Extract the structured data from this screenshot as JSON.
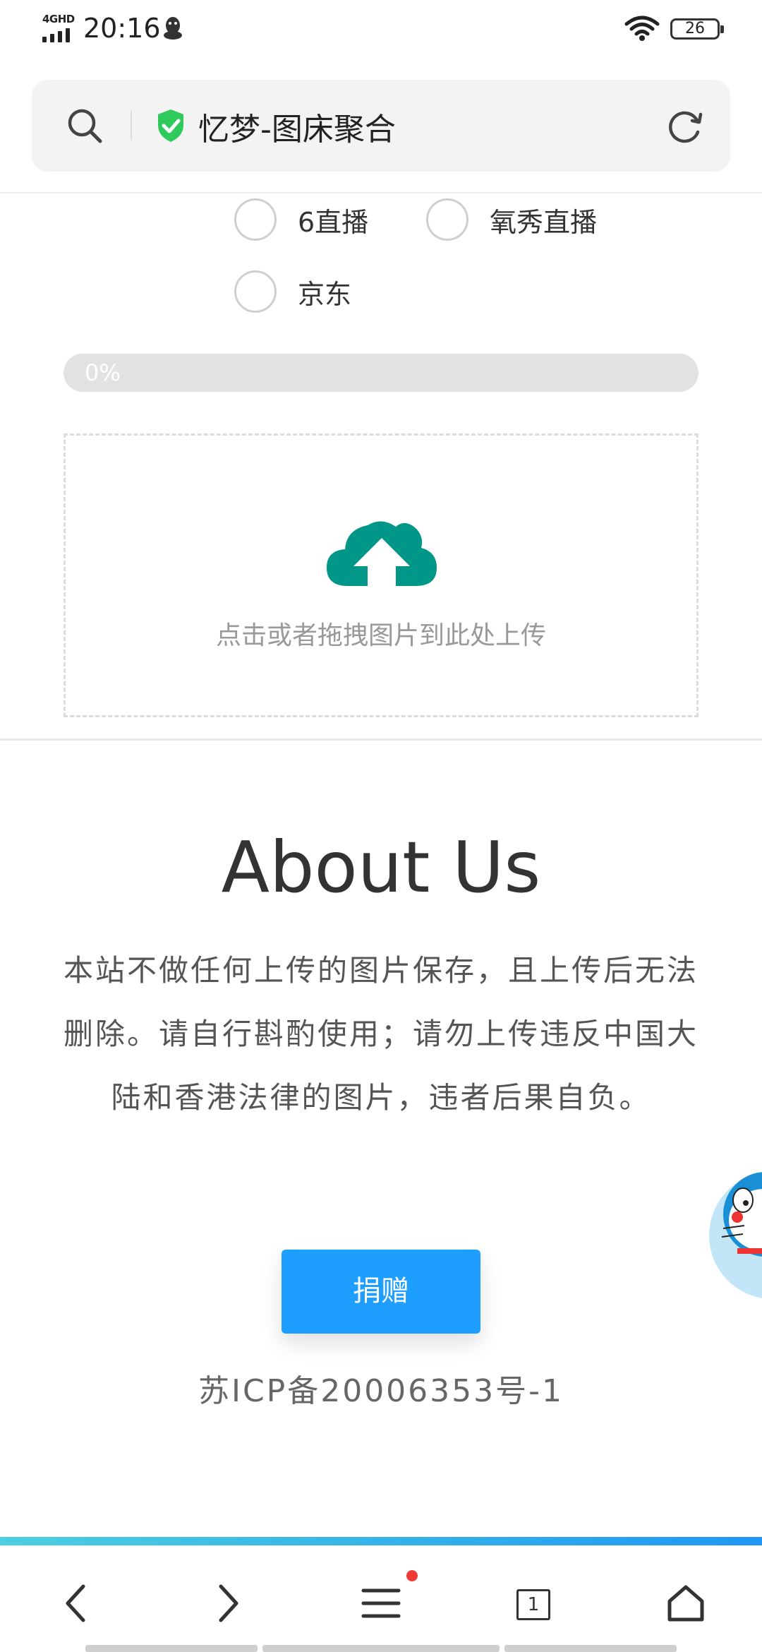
{
  "status_bar": {
    "network": "4GHD",
    "time": "20:16",
    "battery": "26"
  },
  "address_bar": {
    "title": "忆梦-图床聚合"
  },
  "upload_options": [
    {
      "label": "6直播"
    },
    {
      "label": "氧秀直播"
    },
    {
      "label": "京东"
    }
  ],
  "progress": {
    "text": "0%",
    "value": 0
  },
  "upload_zone": {
    "hint": "点击或者拖拽图片到此处上传"
  },
  "about": {
    "title": "About Us",
    "text": "本站不做任何上传的图片保存，且上传后无法删除。请自行斟酌使用；请勿上传违反中国大陆和香港法律的图片，违者后果自负。"
  },
  "donate": {
    "label": "捐赠"
  },
  "footer": {
    "icp": "苏ICP备20006353号-1"
  },
  "bottom_nav": {
    "tab_count": "1"
  },
  "colors": {
    "accent": "#1e9fff",
    "cloud": "#009688",
    "shield": "#2fc95c"
  }
}
